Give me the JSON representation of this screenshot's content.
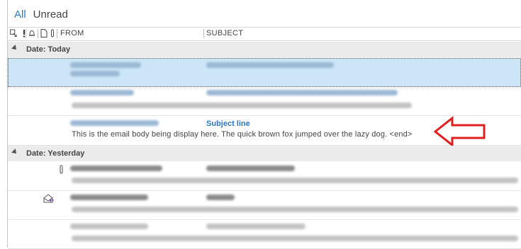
{
  "filters": {
    "all": "All",
    "unread": "Unread"
  },
  "columns": {
    "from": "FROM",
    "subject": "SUBJECT"
  },
  "groups": {
    "today": "Date: Today",
    "yesterday": "Date: Yesterday"
  },
  "highlighted_message": {
    "subject": "Subject line",
    "preview": "This is the email body being display here. The quick brown fox jumped over the lazy dog. <end>"
  },
  "colors": {
    "accent": "#2b79c2",
    "selection": "#cde6f7",
    "arrow": "#e02020"
  },
  "icons": [
    "sort-icon",
    "importance-icon",
    "reminder-icon",
    "document-icon",
    "attachment-icon",
    "paperclip-icon",
    "envelope-reply-icon",
    "red-arrow-icon"
  ]
}
